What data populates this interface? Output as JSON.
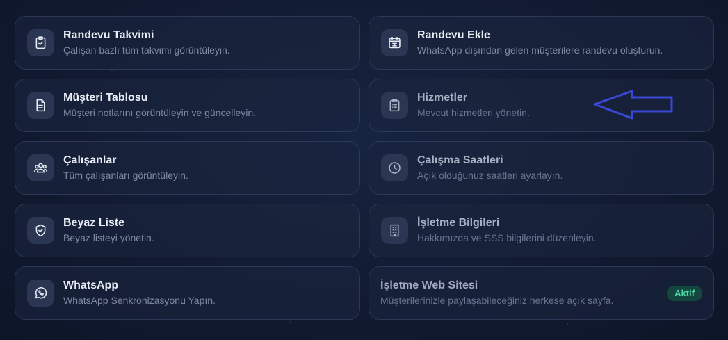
{
  "cards": [
    {
      "title": "Randevu Takvimi",
      "desc": "Çalışan bazlı tüm takvimi görüntüleyin.",
      "icon": "clipboard-check-icon"
    },
    {
      "title": "Randevu Ekle",
      "desc": "WhatsApp dışından gelen müşterilere randevu oluşturun.",
      "icon": "calendar-plus-icon"
    },
    {
      "title": "Müşteri Tablosu",
      "desc": "Müşteri notlarını görüntüleyin ve güncelleyin.",
      "icon": "document-icon"
    },
    {
      "title": "Hizmetler",
      "desc": "Mevcut hizmetleri yönetin.",
      "icon": "clipboard-list-icon"
    },
    {
      "title": "Çalışanlar",
      "desc": "Tüm çalışanları görüntüleyin.",
      "icon": "users-icon"
    },
    {
      "title": "Çalışma Saatleri",
      "desc": "Açık olduğunuz saatleri ayarlayın.",
      "icon": "clock-icon"
    },
    {
      "title": "Beyaz Liste",
      "desc": "Beyaz listeyi yönetin.",
      "icon": "shield-check-icon"
    },
    {
      "title": "İşletme Bilgileri",
      "desc": "Hakkımızda ve SSS bilgilerini düzenleyin.",
      "icon": "building-icon"
    },
    {
      "title": "WhatsApp",
      "desc": "WhatsApp Senkronizasyonu Yapın.",
      "icon": "whatsapp-icon"
    },
    {
      "title": "İşletme Web Sitesi",
      "desc": "Müşterilerinizle paylaşabileceğiniz herkese açık sayfa.",
      "badge": "Aktif"
    }
  ],
  "colors": {
    "background": "#111a30",
    "card_border": "#2b3856",
    "badge_bg": "#14473f",
    "badge_text": "#4fd6a6",
    "annotation_arrow": "#3b48d6"
  },
  "annotation": {
    "type": "arrow",
    "points_to": "Hizmetler"
  }
}
